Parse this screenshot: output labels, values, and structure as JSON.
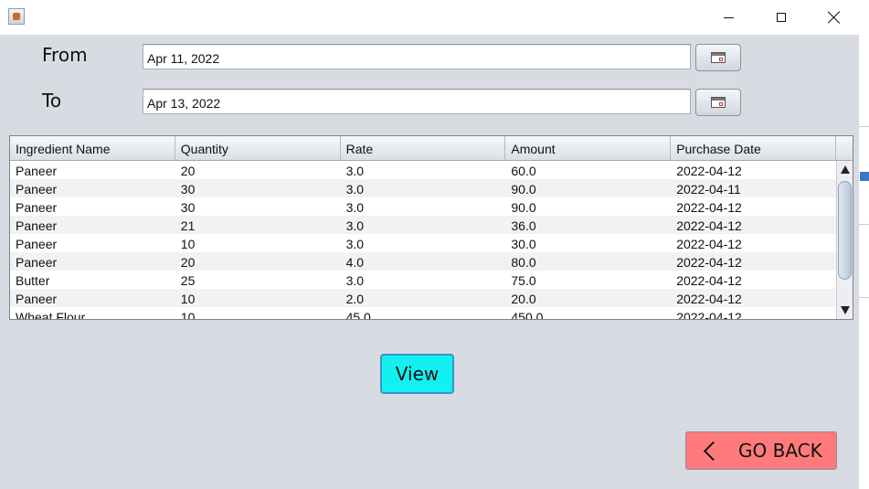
{
  "form": {
    "from_label": "From",
    "to_label": "To",
    "from_value": "Apr 11, 2022",
    "to_value": "Apr 13, 2022"
  },
  "table": {
    "columns": [
      "Ingredient Name",
      "Quantity",
      "Rate",
      "Amount",
      "Purchase Date"
    ],
    "rows": [
      [
        "Paneer",
        "20",
        "3.0",
        "60.0",
        "2022-04-12"
      ],
      [
        "Paneer",
        "30",
        "3.0",
        "90.0",
        "2022-04-11"
      ],
      [
        "Paneer",
        "30",
        "3.0",
        "90.0",
        "2022-04-12"
      ],
      [
        "Paneer",
        "21",
        "3.0",
        "36.0",
        "2022-04-12"
      ],
      [
        "Paneer",
        "10",
        "3.0",
        "30.0",
        "2022-04-12"
      ],
      [
        "Paneer",
        "20",
        "4.0",
        "80.0",
        "2022-04-12"
      ],
      [
        "Butter",
        "25",
        "3.0",
        "75.0",
        "2022-04-12"
      ],
      [
        "Paneer",
        "10",
        "2.0",
        "20.0",
        "2022-04-12"
      ],
      [
        "Wheat Flour",
        "10",
        "45.0",
        "450.0",
        "2022-04-12"
      ]
    ]
  },
  "buttons": {
    "view_label": "View",
    "back_label": "GO BACK"
  },
  "icons": {
    "app": "java-app-icon",
    "calendar": "calendar-icon",
    "back": "chevron-left-icon"
  },
  "colors": {
    "view_button": "#14f0f0",
    "back_button": "#ff7b7b",
    "window_bg": "#d9dbe3"
  }
}
